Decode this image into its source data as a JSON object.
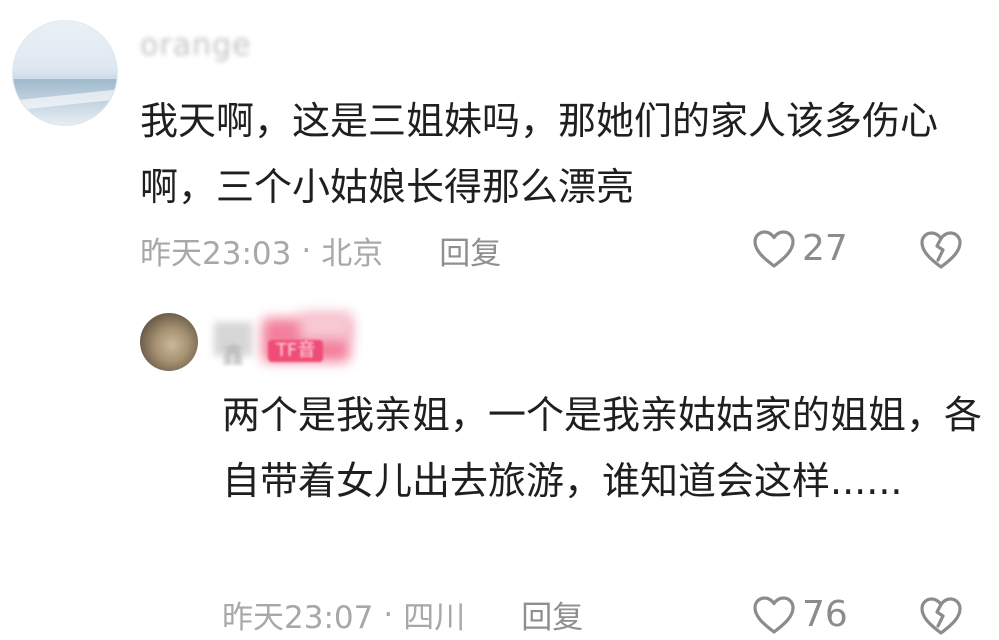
{
  "comments": [
    {
      "username": "orange",
      "text": "我天啊，这是三姐妹吗，那她们的家人该多伤心啊，三个小姑娘长得那么漂亮",
      "time": "昨天23:03",
      "separator": "·",
      "location": "北京",
      "reply_label": "回复",
      "likes": "27"
    },
    {
      "username": "鑫",
      "badge": "TF音",
      "text": "两个是我亲姐，一个是我亲姑姑家的姐姐，各自带着女儿出去旅游，谁知道会这样......",
      "time": "昨天23:07",
      "separator": "·",
      "location": "四川",
      "reply_label": "回复",
      "likes": "76"
    }
  ],
  "icons": {
    "like": "heart-outline-icon",
    "dislike": "broken-heart-icon"
  },
  "colors": {
    "meta_text": "#a8a8a8",
    "icon_stroke": "#8c8c8c",
    "badge": "#ef4d77"
  }
}
